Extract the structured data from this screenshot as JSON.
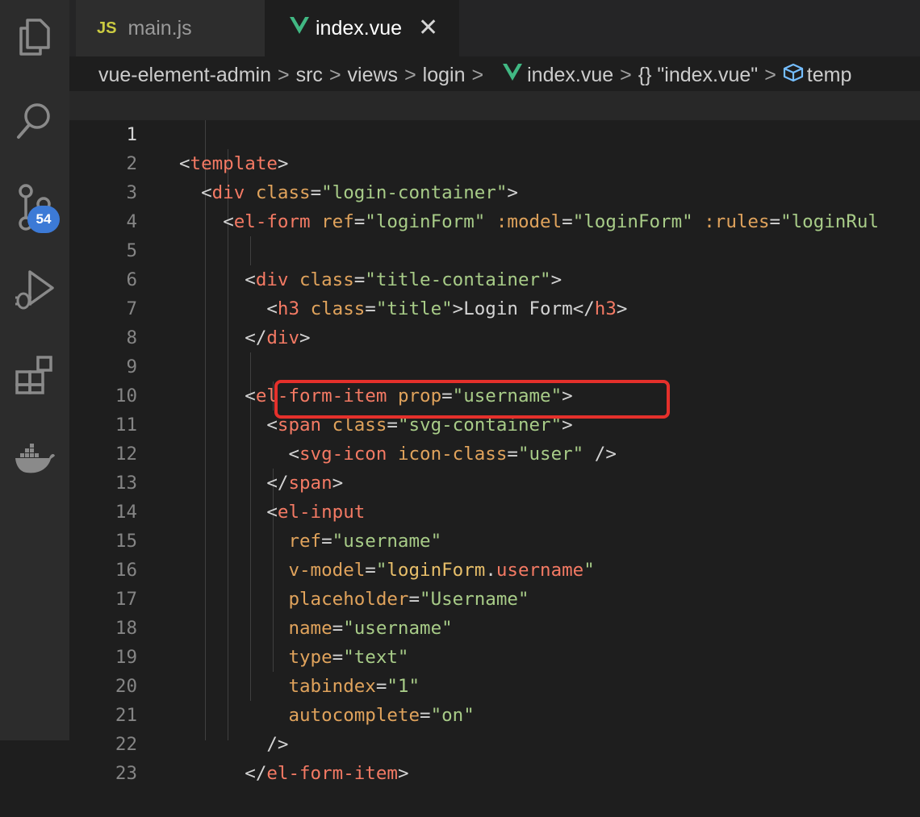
{
  "activity_bar": {
    "items": [
      {
        "name": "explorer-icon"
      },
      {
        "name": "search-icon"
      },
      {
        "name": "source-control-icon",
        "badge": "54"
      },
      {
        "name": "run-debug-icon"
      },
      {
        "name": "extensions-icon"
      },
      {
        "name": "docker-icon"
      }
    ],
    "source_control_badge": "54"
  },
  "tabs": [
    {
      "label": "main.js",
      "icon_text": "JS",
      "active": false
    },
    {
      "label": "index.vue",
      "active": true,
      "close": "✕"
    }
  ],
  "breadcrumbs": {
    "items": [
      "vue-element-admin",
      "src",
      "views",
      "login",
      "index.vue",
      "{}",
      "\"index.vue\"",
      "temp"
    ],
    "separator": ">"
  },
  "editor": {
    "active_line": 1,
    "lines": [
      {
        "n": "1"
      },
      {
        "n": "2"
      },
      {
        "n": "3"
      },
      {
        "n": "4"
      },
      {
        "n": "5"
      },
      {
        "n": "6"
      },
      {
        "n": "7"
      },
      {
        "n": "8"
      },
      {
        "n": "9"
      },
      {
        "n": "10"
      },
      {
        "n": "11"
      },
      {
        "n": "12"
      },
      {
        "n": "13"
      },
      {
        "n": "14"
      },
      {
        "n": "15"
      },
      {
        "n": "16"
      },
      {
        "n": "17"
      },
      {
        "n": "18"
      },
      {
        "n": "19"
      },
      {
        "n": "20"
      },
      {
        "n": "21"
      },
      {
        "n": "22"
      },
      {
        "n": "23"
      }
    ],
    "code": {
      "l1": {
        "tag": "template"
      },
      "l2": {
        "tag": "div",
        "attr": "class",
        "val": "\"login-container\""
      },
      "l3": {
        "tag": "el-form",
        "a1": "ref",
        "v1": "\"loginForm\"",
        "a2": ":model",
        "v2": "\"loginForm\"",
        "a3": ":rules",
        "v3": "\"loginRul"
      },
      "l5": {
        "tag": "div",
        "attr": "class",
        "val": "\"title-container\""
      },
      "l6": {
        "tag": "h3",
        "attr": "class",
        "val": "\"title\"",
        "text": "Login Form",
        "close": "h3"
      },
      "l7": {
        "close": "div"
      },
      "l9": {
        "tag": "el-form-item",
        "attr": "prop",
        "val": "\"username\""
      },
      "l10": {
        "tag": "span",
        "attr": "class",
        "val": "\"svg-container\""
      },
      "l11": {
        "tag": "svg-icon",
        "attr": "icon-class",
        "val": "\"user\"",
        "end": "/>"
      },
      "l12": {
        "close": "span"
      },
      "l13": {
        "tag": "el-input"
      },
      "l14": {
        "attr": "ref",
        "val": "\"username\""
      },
      "l15": {
        "attr": "v-model",
        "q1": "\"",
        "obj": "loginForm",
        "dot": ".",
        "prop": "username",
        "q2": "\""
      },
      "l16": {
        "attr": "placeholder",
        "val": "\"Username\""
      },
      "l17": {
        "attr": "name",
        "val": "\"username\""
      },
      "l18": {
        "attr": "type",
        "val": "\"text\""
      },
      "l19": {
        "attr": "tabindex",
        "val": "\"1\""
      },
      "l20": {
        "attr": "autocomplete",
        "val": "\"on\""
      },
      "l21": {
        "end": "/>"
      },
      "l22": {
        "close": "el-form-item"
      }
    }
  },
  "colors": {
    "background": "#1e1e1e",
    "tag": "#f47a64",
    "attribute": "#e0a35c",
    "string": "#a8cc88",
    "highlight_box": "#e5302b",
    "badge": "#3c7ad6"
  }
}
